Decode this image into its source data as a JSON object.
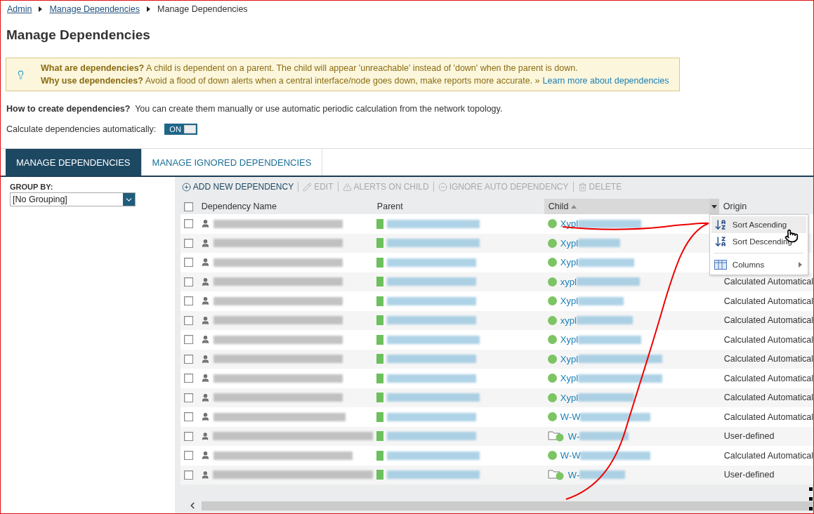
{
  "breadcrumb": [
    {
      "label": "Admin",
      "link": true
    },
    {
      "label": "Manage Dependencies",
      "link": true
    },
    {
      "label": "Manage Dependencies",
      "link": false
    }
  ],
  "title": "Manage Dependencies",
  "info": {
    "lines": [
      {
        "heading": "What are dependencies?",
        "text": "A child is dependent on a parent. The child will appear 'unreachable' instead of 'down' when the parent is down."
      },
      {
        "heading": "Why use dependencies?",
        "text": "Avoid a flood of down alerts when a central interface/node goes down, make reports more accurate. »"
      }
    ],
    "link": "Learn more about dependencies"
  },
  "how_to": {
    "heading": "How to create dependencies?",
    "text": "You can create them manually or use automatic periodic calculation from the network topology."
  },
  "auto_calc": {
    "label": "Calculate dependencies automatically:",
    "toggle": {
      "label": "ON",
      "on": true
    }
  },
  "tabs": [
    {
      "label": "MANAGE DEPENDENCIES",
      "selected": true
    },
    {
      "label": "MANAGE IGNORED DEPENDENCIES",
      "selected": false
    }
  ],
  "group_by": {
    "label": "GROUP BY:",
    "value": "[No Grouping]"
  },
  "toolbar": [
    {
      "kind": "add",
      "label": "ADD NEW DEPENDENCY",
      "disabled": false
    },
    {
      "kind": "edit",
      "label": "EDIT",
      "disabled": true
    },
    {
      "kind": "alert",
      "label": "ALERTS ON CHILD",
      "disabled": true
    },
    {
      "kind": "ignore",
      "label": "IGNORE AUTO DEPENDENCY",
      "disabled": true
    },
    {
      "kind": "delete",
      "label": "DELETE",
      "disabled": true
    }
  ],
  "table": {
    "select_all": {
      "checked": false
    },
    "columns": [
      {
        "label": "Dependency Name",
        "sorted": false
      },
      {
        "label": "Parent",
        "sorted": false
      },
      {
        "label": "Child",
        "sorted": true
      },
      {
        "label": "Origin",
        "sorted": false
      }
    ],
    "rows": [
      {
        "checked": false,
        "kind": "node",
        "child": "Xypl"
      },
      {
        "checked": false,
        "kind": "node",
        "child": "Xypl"
      },
      {
        "checked": false,
        "kind": "node",
        "child": "Xypl"
      },
      {
        "checked": false,
        "kind": "node",
        "child": "xypl",
        "origin": "Calculated Automatical"
      },
      {
        "checked": false,
        "kind": "node",
        "child": "Xypl",
        "origin": "Calculated Automatical"
      },
      {
        "checked": false,
        "kind": "node",
        "child": "xypl",
        "origin": "Calculated Automatical"
      },
      {
        "checked": false,
        "kind": "node",
        "child": "Xypl",
        "origin": "Calculated Automatical"
      },
      {
        "checked": false,
        "kind": "node",
        "child": "Xypl",
        "origin": "Calculated Automatical"
      },
      {
        "checked": false,
        "kind": "node",
        "child": "Xypl",
        "origin": "Calculated Automatical"
      },
      {
        "checked": false,
        "kind": "node",
        "child": "Xypl",
        "origin": "Calculated Automatical"
      },
      {
        "checked": false,
        "kind": "node",
        "child": "W-W",
        "origin": "Calculated Automatical"
      },
      {
        "checked": false,
        "kind": "group",
        "child": "W-",
        "origin": "User-defined"
      },
      {
        "checked": false,
        "kind": "node",
        "child": "W-W",
        "origin": "Calculated Automatical"
      },
      {
        "checked": false,
        "kind": "group",
        "child": "W-",
        "origin": "User-defined"
      }
    ]
  },
  "column_menu": {
    "items": [
      {
        "kind": "sort_asc",
        "label": "Sort Ascending",
        "hovered": true
      },
      {
        "kind": "sort_desc",
        "label": "Sort Descending",
        "hovered": false
      },
      {
        "kind": "columns",
        "label": "Columns",
        "hovered": false
      }
    ]
  }
}
